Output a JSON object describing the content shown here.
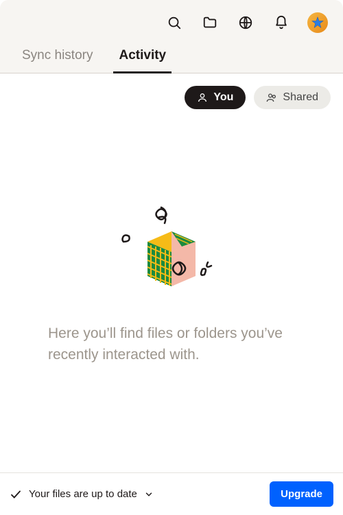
{
  "tabs": {
    "sync_history": "Sync history",
    "activity": "Activity"
  },
  "filters": {
    "you": "You",
    "shared": "Shared"
  },
  "empty_message": "Here you’ll find files or folders you’ve recently interacted with.",
  "status": {
    "text": "Your files are up to date",
    "upgrade": "Upgrade"
  }
}
